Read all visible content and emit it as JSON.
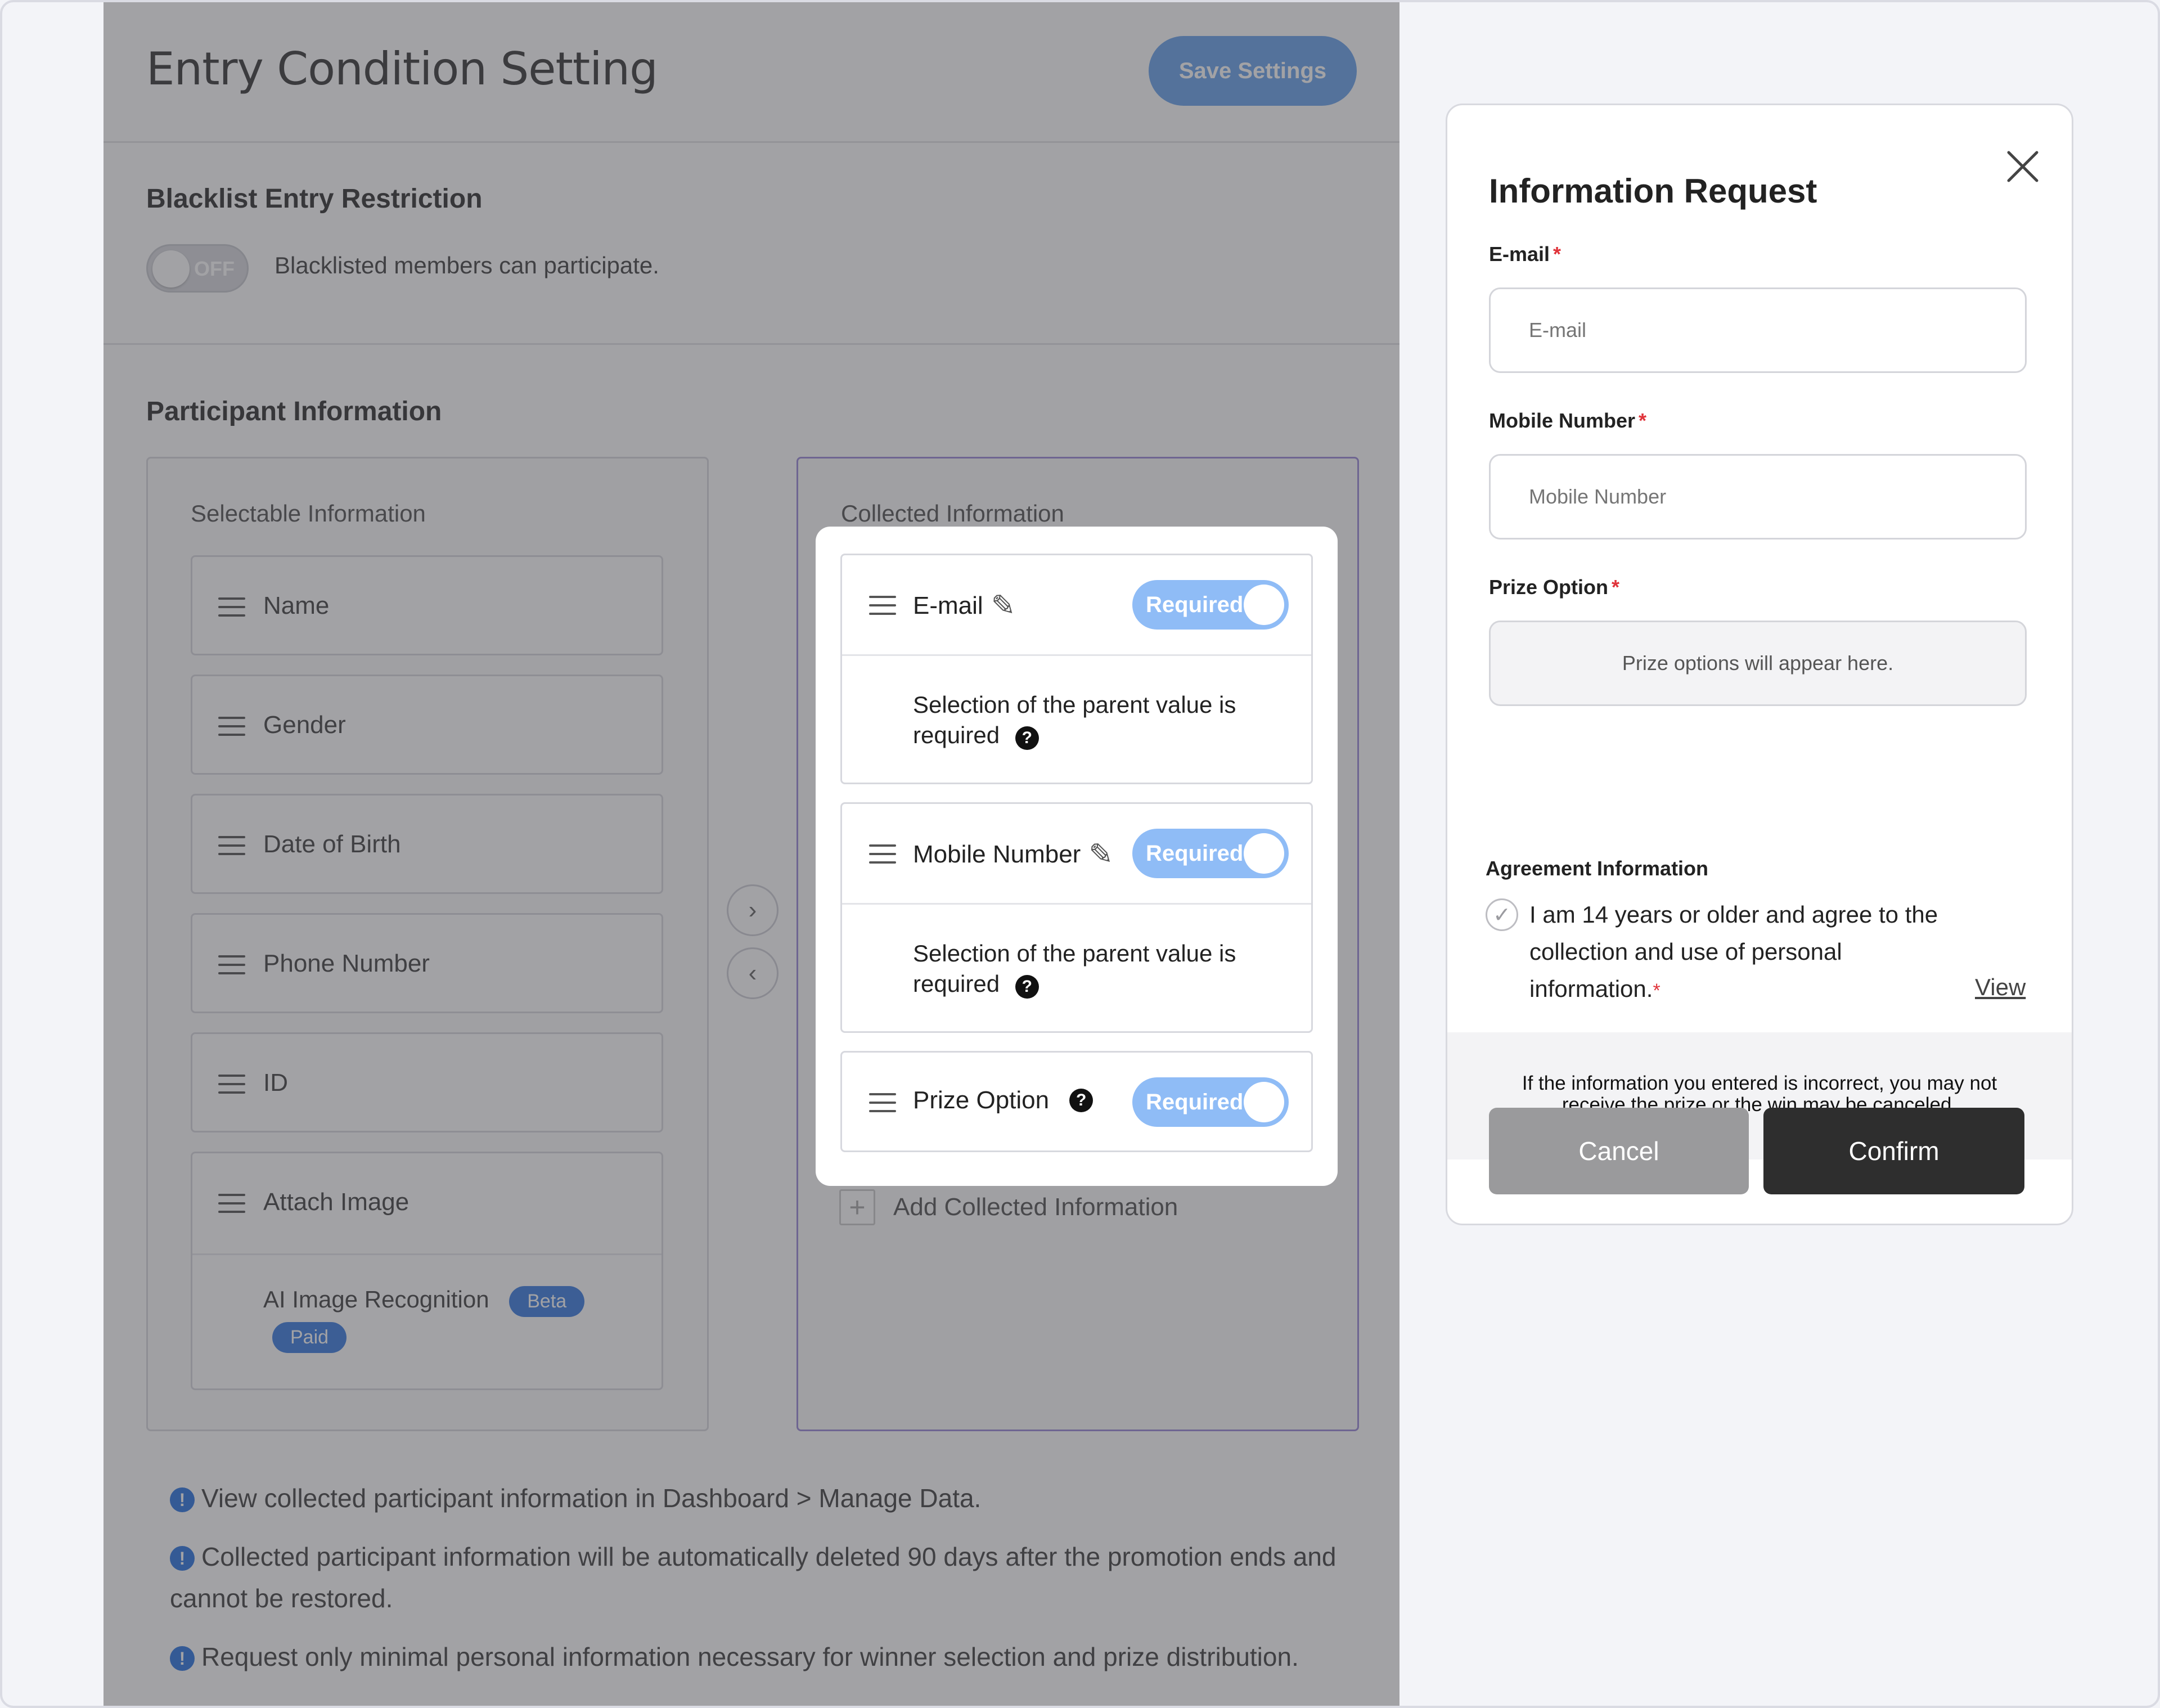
{
  "settings": {
    "title": "Entry Condition Setting",
    "save_label": "Save Settings",
    "blacklist": {
      "title": "Blacklist Entry Restriction",
      "toggle_state": "OFF",
      "description": "Blacklisted members can participate."
    },
    "participant": {
      "title": "Participant Information",
      "selectable_label": "Selectable Information",
      "selectable_items": [
        "Name",
        "Gender",
        "Date of Birth",
        "Phone Number",
        "ID",
        "Attach Image"
      ],
      "ai_recognition": {
        "label": "AI Image Recognition",
        "badge_beta": "Beta",
        "badge_paid": "Paid"
      },
      "collected_label": "Collected Information",
      "collected_items": [
        {
          "label": "E-mail",
          "toggle": "Required",
          "sub": "Selection of the parent value is required"
        },
        {
          "label": "Mobile Number",
          "toggle": "Required",
          "sub": "Selection of the parent value is required"
        },
        {
          "label": "Prize Option",
          "toggle": "Required"
        }
      ],
      "add_label": "Add Collected Information"
    },
    "notes": [
      "View collected participant information in Dashboard > Manage Data.",
      "Collected participant information will be automatically deleted 90 days after the promotion ends and cannot be restored.",
      "Request only minimal personal information necessary for winner selection and prize distribution."
    ]
  },
  "modal": {
    "title": "Information Request",
    "email": {
      "label": "E-mail",
      "placeholder": "E-mail"
    },
    "mobile": {
      "label": "Mobile Number",
      "placeholder": "Mobile Number"
    },
    "prize": {
      "label": "Prize Option",
      "placeholder": "Prize options will appear here."
    },
    "agreement": {
      "title": "Agreement Information",
      "text": "I am 14 years or older and agree to the collection and use of personal information.",
      "view_label": "View"
    },
    "notice": "If the information you entered is incorrect, you may not receive the prize or the win may be canceled.",
    "cancel_label": "Cancel",
    "confirm_label": "Confirm"
  },
  "colors": {
    "accent": "#3d7ee0",
    "required_toggle": "#8fbcf6",
    "confirm": "#2e2e2e",
    "required_star": "#e0333a"
  }
}
